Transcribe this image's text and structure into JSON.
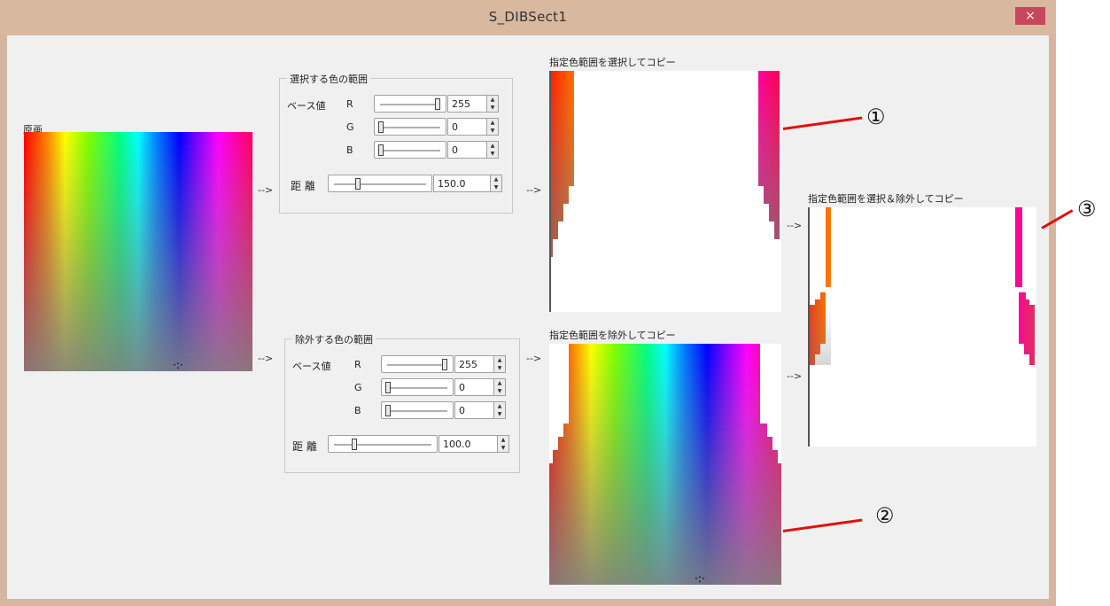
{
  "window": {
    "title": "S_DIBSect1",
    "close_label": "×"
  },
  "source": {
    "label": "原画"
  },
  "arrow_text": "-->",
  "select_group": {
    "title": "選択する色の範囲",
    "base_label": "ベース値",
    "distance_label": "距 離",
    "channels": [
      {
        "name": "R",
        "value": "255",
        "level": 1.0
      },
      {
        "name": "G",
        "value": "0",
        "level": 0.0
      },
      {
        "name": "B",
        "value": "0",
        "level": 0.0
      }
    ],
    "distance": {
      "value": "150.0"
    }
  },
  "exclude_group": {
    "title": "除外する色の範囲",
    "base_label": "ベース値",
    "distance_label": "距 離",
    "channels": [
      {
        "name": "R",
        "value": "255",
        "level": 1.0
      },
      {
        "name": "G",
        "value": "0",
        "level": 0.0
      },
      {
        "name": "B",
        "value": "0",
        "level": 0.0
      }
    ],
    "distance": {
      "value": "100.0"
    }
  },
  "results": {
    "select_copy_label": "指定色範囲を選択してコピー",
    "exclude_copy_label": "指定色範囲を除外してコピー",
    "select_exclude_copy_label": "指定色範囲を選択＆除外してコピー"
  },
  "annotations": [
    "①",
    "②",
    "③"
  ],
  "colors": {
    "annotation_line": "#e01010",
    "title_bar": "#d8b89f",
    "close": "#c8475b"
  }
}
